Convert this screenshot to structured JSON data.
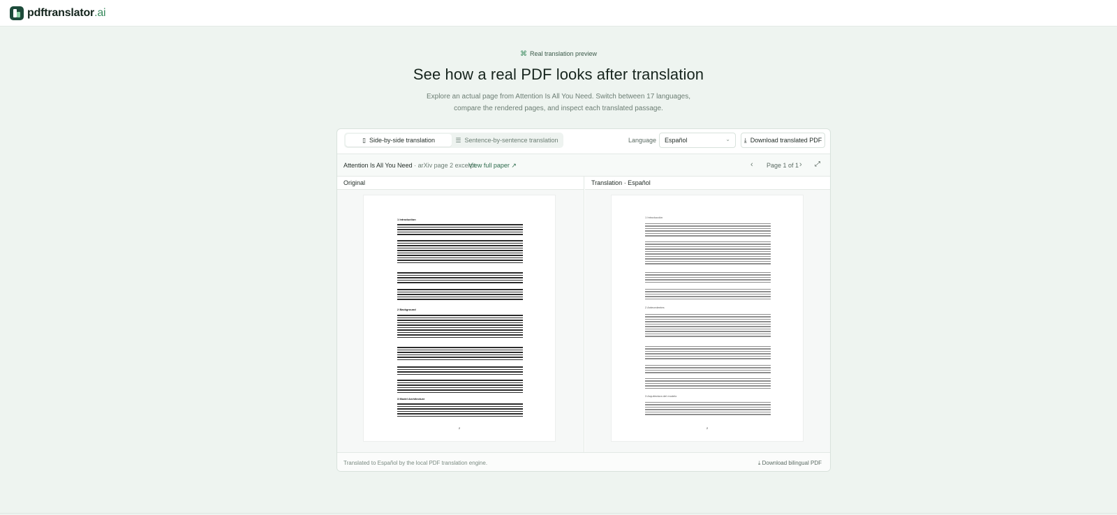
{
  "brand": {
    "name": "pdftranslator",
    "tld": ".ai",
    "icon": "logo-icon"
  },
  "hero": {
    "tag_icon": "translate-icon",
    "tag": "Real translation preview",
    "title": "See how a real PDF looks after translation",
    "subtitle_line1": "Explore an actual page from Attention Is All You Need. Switch between 17 languages,",
    "subtitle_line2": "compare the rendered pages, and inspect each translated passage."
  },
  "toolbar": {
    "tabs": [
      {
        "label": "Side-by-side translation",
        "icon": "columns-icon",
        "active": true
      },
      {
        "label": "Sentence-by-sentence translation",
        "icon": "list-icon",
        "active": false
      }
    ],
    "language_label": "Language",
    "language_value": "Español",
    "download_label": "Download translated PDF"
  },
  "doc": {
    "title": "Attention Is All You Need",
    "meta": " · arXiv page 2 excerpt",
    "view_link": "View full paper",
    "page_text": "Page 1 of 1"
  },
  "panes": {
    "original_label": "Original",
    "translation_label": "Translation · Español",
    "original_sections": [
      "1 Introduction",
      "2 Background",
      "3 Model Architecture"
    ],
    "translation_sections": [
      "1 Introducción",
      "2 Antecedentes",
      "3 Arquitectura del modelo"
    ],
    "page_number": "2"
  },
  "footer": {
    "note": "Translated to Español by the local PDF translation engine.",
    "download_bilingual": "Download bilingual PDF"
  }
}
